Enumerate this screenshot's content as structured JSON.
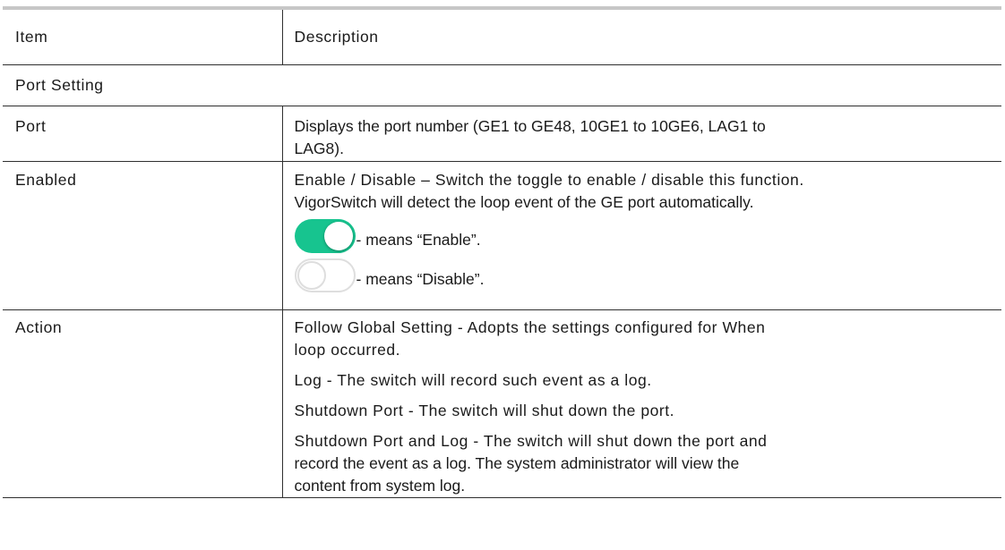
{
  "table": {
    "header": {
      "item": "Item",
      "description": "Description"
    },
    "section": "Port Setting",
    "rows": {
      "port": {
        "item": "Port",
        "desc_line1": "Displays the port number (GE1 to GE48, 10GE1 to 10GE6, LAG1 to",
        "desc_line2": "LAG8)."
      },
      "enabled": {
        "item": "Enabled",
        "desc_line1": "Enable / Disable – Switch the toggle to enable / disable this function.",
        "desc_line2": "VigorSwitch will detect the loop event of the GE port automatically.",
        "toggle_on_text": "- means “Enable”.",
        "toggle_off_text": "- means “Disable”.",
        "toggle_on_state": "on",
        "toggle_off_state": "off",
        "toggle_on_color": "#17c48f"
      },
      "action": {
        "item": "Action",
        "desc_line1": "Follow Global Setting - Adopts the settings configured for When",
        "desc_line2": "loop occurred.",
        "desc_line3": "Log - The switch will record such event as a log.",
        "desc_line4": "Shutdown Port - The switch will shut down the port.",
        "desc_line5": "Shutdown Port and Log - The switch will shut down the port and",
        "desc_line6": "record the event as a log. The system administrator will view the",
        "desc_line7": "content from system log."
      }
    }
  }
}
